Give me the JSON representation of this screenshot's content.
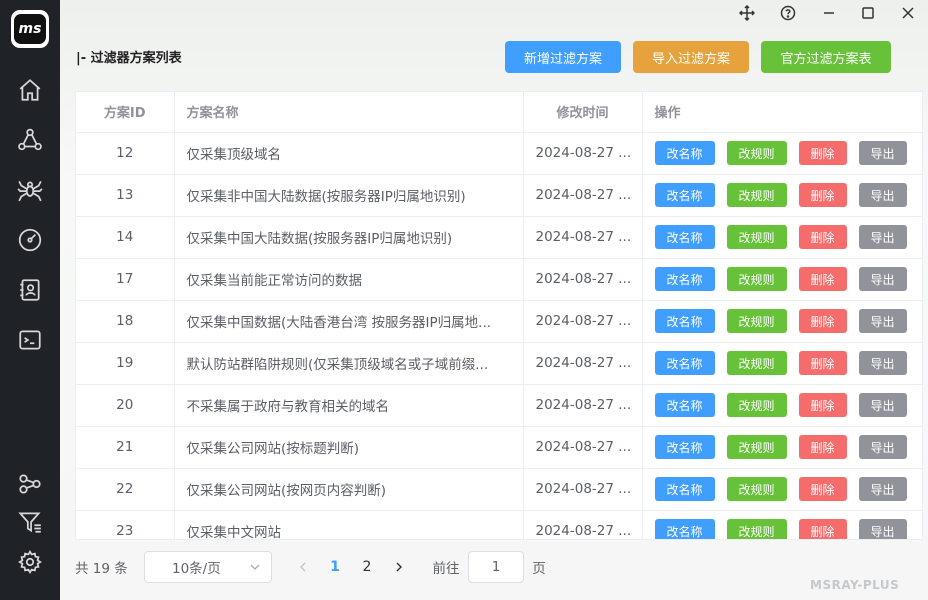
{
  "app": {
    "logo_text": "ms",
    "watermark": "MSRAY-PLUS"
  },
  "sidebar": {
    "items": [
      {
        "name": "home-icon"
      },
      {
        "name": "share-nodes-icon"
      },
      {
        "name": "spider-icon"
      },
      {
        "name": "gauge-icon"
      },
      {
        "name": "contact-card-icon"
      },
      {
        "name": "terminal-icon"
      },
      {
        "name": "network-icon"
      },
      {
        "name": "filter-list-icon"
      },
      {
        "name": "gear-icon"
      }
    ]
  },
  "window_controls": [
    "move-icon",
    "help-icon",
    "minimize-icon",
    "maximize-icon",
    "close-icon"
  ],
  "page": {
    "title": "|- 过滤器方案列表"
  },
  "toolbar": {
    "add_label": "新增过滤方案",
    "import_label": "导入过滤方案",
    "official_label": "官方过滤方案表"
  },
  "colors": {
    "primary": "#409eff",
    "warning": "#e6a23c",
    "success": "#67c23a",
    "danger": "#f56c6c",
    "info": "#909399"
  },
  "table": {
    "headers": {
      "id": "方案ID",
      "name": "方案名称",
      "time": "修改时间",
      "ops": "操作"
    },
    "op_labels": {
      "rename": "改名称",
      "edit_rules": "改规则",
      "delete": "删除",
      "export": "导出"
    },
    "rows": [
      {
        "id": "12",
        "name": "仅采集顶级域名",
        "time": "2024-08-27 ..."
      },
      {
        "id": "13",
        "name": "仅采集非中国大陆数据(按服务器IP归属地识别)",
        "time": "2024-08-27 ..."
      },
      {
        "id": "14",
        "name": "仅采集中国大陆数据(按服务器IP归属地识别)",
        "time": "2024-08-27 ..."
      },
      {
        "id": "17",
        "name": "仅采集当前能正常访问的数据",
        "time": "2024-08-27 ..."
      },
      {
        "id": "18",
        "name": "仅采集中国数据(大陆香港台湾 按服务器IP归属地...",
        "time": "2024-08-27 ..."
      },
      {
        "id": "19",
        "name": "默认防站群陷阱规则(仅采集顶级域名或子域前缀...",
        "time": "2024-08-27 ..."
      },
      {
        "id": "20",
        "name": "不采集属于政府与教育相关的域名",
        "time": "2024-08-27 ..."
      },
      {
        "id": "21",
        "name": "仅采集公司网站(按标题判断)",
        "time": "2024-08-27 ..."
      },
      {
        "id": "22",
        "name": "仅采集公司网站(按网页内容判断)",
        "time": "2024-08-27 ..."
      },
      {
        "id": "23",
        "name": "仅采集中文网站",
        "time": "2024-08-27 ..."
      }
    ]
  },
  "pagination": {
    "total_text": "共 19 条",
    "page_size": "10条/页",
    "pages": [
      "1",
      "2"
    ],
    "current_page": "1",
    "goto_label": "前往",
    "goto_value": "1",
    "page_suffix": "页"
  }
}
